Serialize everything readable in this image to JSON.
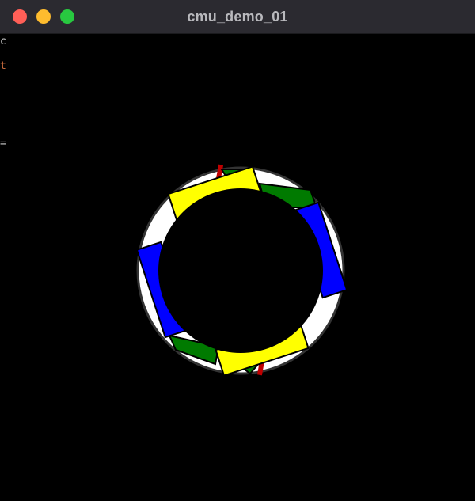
{
  "window": {
    "title": "cmu_demo_01",
    "buttons": {
      "close_color": "#ff5f57",
      "minimize_color": "#febc2e",
      "maximize_color": "#28c840"
    }
  },
  "scene": {
    "background": "#000000",
    "ring": {
      "fill": "#ffffff",
      "stroke": "#333333"
    },
    "colors": {
      "yellow": "#ffff00",
      "blue": "#0000ff",
      "green": "#007a00",
      "red": "#c00000"
    }
  }
}
